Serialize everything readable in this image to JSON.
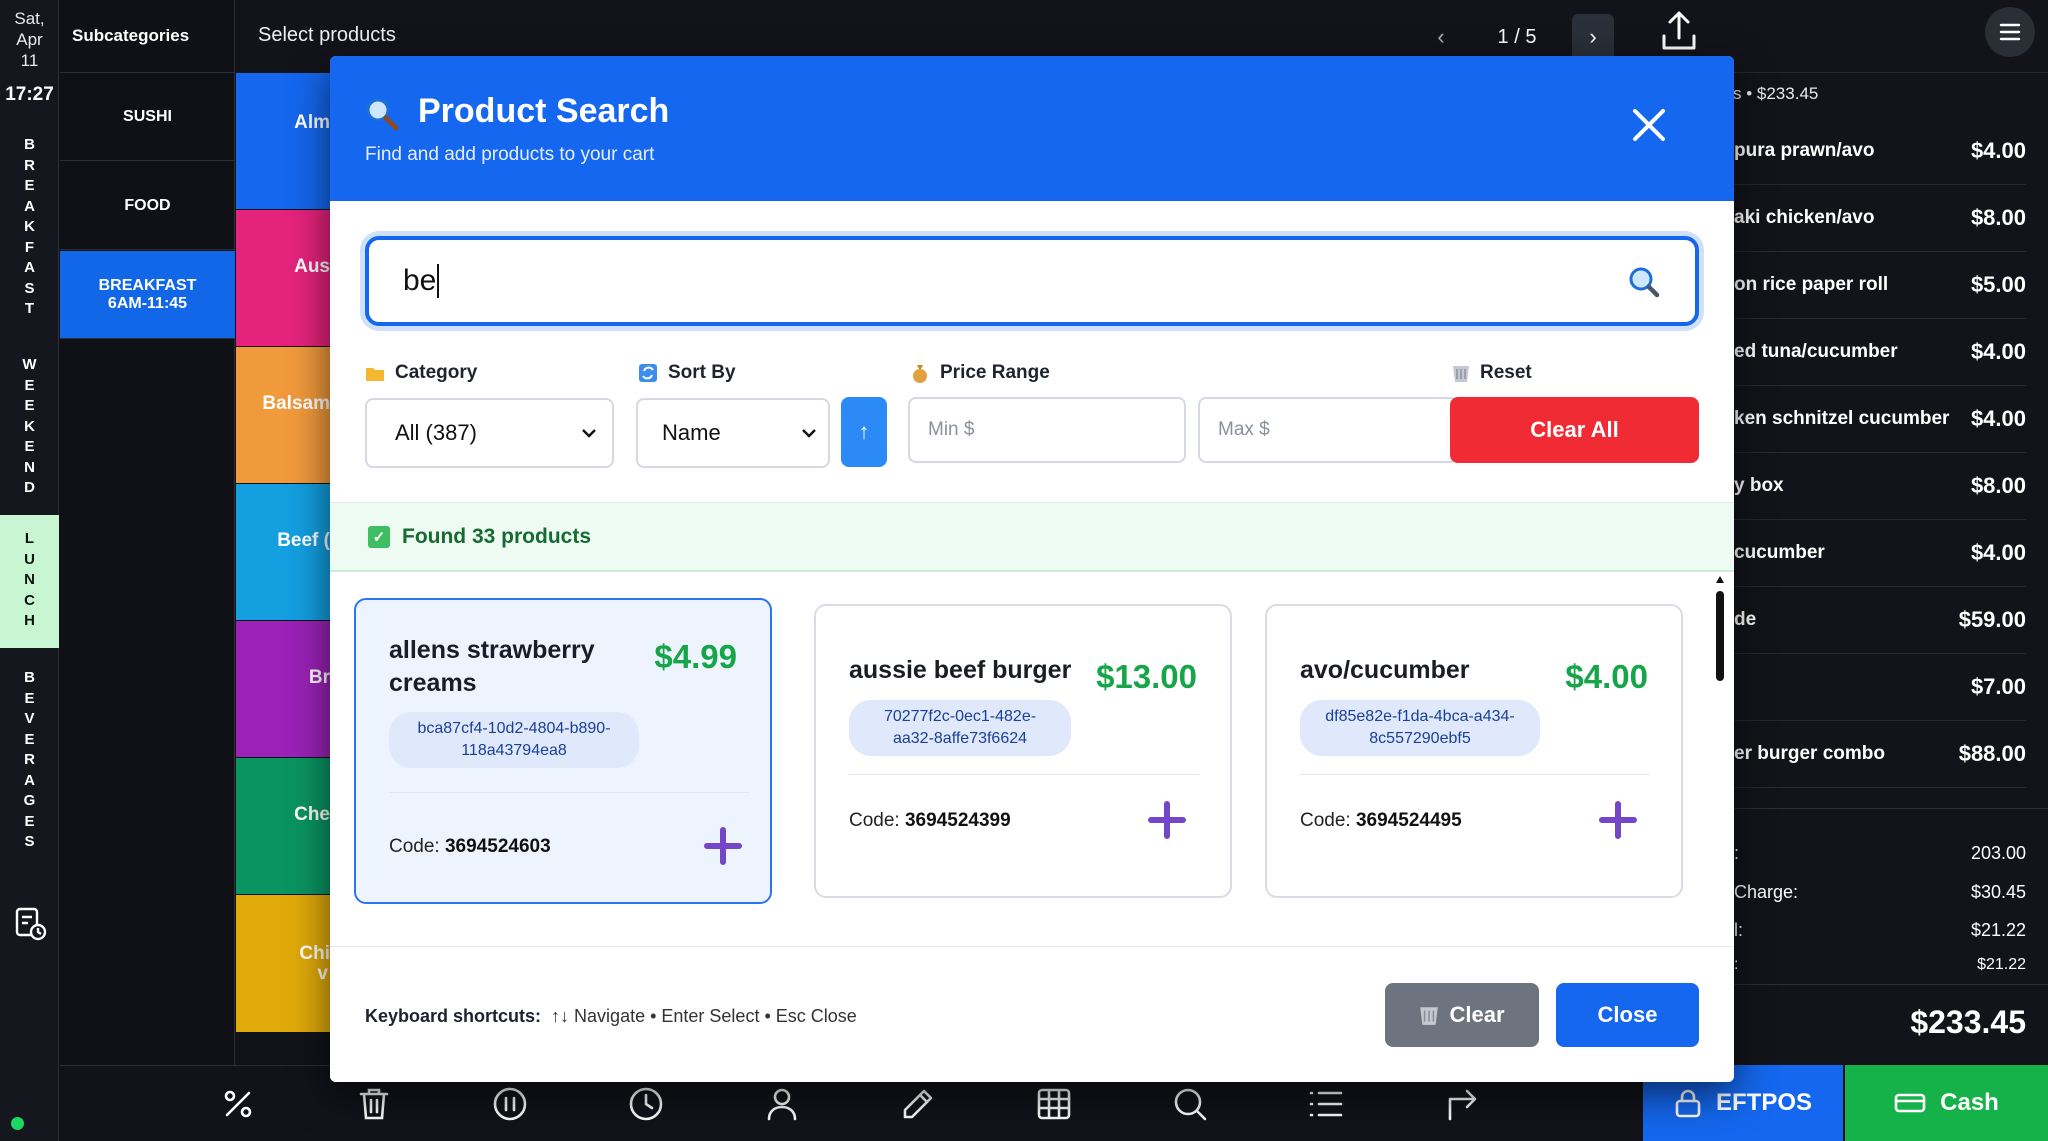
{
  "rail": {
    "date_lines": [
      "Sat,",
      "Apr",
      "11"
    ],
    "time": "17:27",
    "sections": [
      {
        "letters": [
          "B",
          "R",
          "E",
          "A",
          "K",
          "F",
          "A",
          "S",
          "T"
        ]
      },
      {
        "letters": [
          "W",
          "E",
          "E",
          "K",
          "E",
          "N",
          "D"
        ]
      },
      {
        "letters": [
          "L",
          "U",
          "N",
          "C",
          "H"
        ],
        "active": true
      },
      {
        "letters": [
          "B",
          "E",
          "V",
          "E",
          "R",
          "A",
          "G",
          "E",
          "S"
        ]
      }
    ]
  },
  "subcategories": {
    "title": "Subcategories",
    "items": [
      {
        "label": "SUSHI"
      },
      {
        "label": "FOOD"
      },
      {
        "label": "BREAKFAST 6AM-11:45",
        "active": true
      }
    ]
  },
  "products": {
    "title": "Select products",
    "page": "1 / 5",
    "prev": "‹",
    "next": "›",
    "tiles": [
      {
        "label": "Alm",
        "color": "#1467ee"
      },
      {
        "label": "Aus",
        "color": "#e5237c"
      },
      {
        "label": "Balsam",
        "color": "#f09a3c"
      },
      {
        "label": "Beef (",
        "color": "#139fe0"
      },
      {
        "label": "Br",
        "color": "#9b22b8"
      },
      {
        "label": "Che",
        "color": "#0a9462"
      },
      {
        "label": "Chi",
        "label2": "v",
        "color": "#e0aa0a"
      }
    ]
  },
  "cart": {
    "summary": "s • $233.45",
    "items": [
      {
        "name": "pura prawn/avo",
        "price": "$4.00"
      },
      {
        "name": "aki chicken/avo",
        "price": "$8.00"
      },
      {
        "name": "on rice paper roll",
        "price": "$5.00"
      },
      {
        "name": "ed tuna/cucumber",
        "price": "$4.00"
      },
      {
        "name": "ken schnitzel cucumber",
        "price": "$4.00"
      },
      {
        "name": "y box",
        "price": "$8.00"
      },
      {
        "name": "cucumber",
        "price": "$4.00"
      },
      {
        "name": "de",
        "price": "$59.00"
      },
      {
        "name": "",
        "price": "$7.00"
      },
      {
        "name": "er burger combo",
        "price": "$88.00"
      }
    ],
    "totals": [
      {
        "label": ":",
        "value": "203.00"
      },
      {
        "label": "Charge:",
        "value": "$30.45"
      },
      {
        "label": "l:",
        "value": "$21.22"
      },
      {
        "label": ":",
        "value": "$21.22"
      }
    ],
    "grand_total": "$233.45",
    "eftpos": "EFTPOS",
    "cash": "Cash"
  },
  "modal": {
    "title": "Product Search",
    "subtitle": "Find and add products to your cart",
    "search_value": "be",
    "filters": {
      "category_label": "Category",
      "category_value": "All (387)",
      "sort_label": "Sort By",
      "sort_value": "Name",
      "sort_dir": "↑",
      "price_label": "Price Range",
      "min_placeholder": "Min $",
      "max_placeholder": "Max $",
      "reset_label": "Reset",
      "clear_all": "Clear All"
    },
    "found_text": "Found 33 products",
    "code_label": "Code:",
    "results": [
      {
        "name": "allens strawberry creams",
        "price": "$4.99",
        "id": "bca87cf4-10d2-4804-b890-118a43794ea8",
        "code": "3694524603",
        "selected": true
      },
      {
        "name": "aussie beef burger",
        "price": "$13.00",
        "id": "70277f2c-0ec1-482e-aa32-8affe73f6624",
        "code": "3694524399"
      },
      {
        "name": "avo/cucumber",
        "price": "$4.00",
        "id": "df85e82e-f1da-4bca-a434-8c557290ebf5",
        "code": "3694524495"
      }
    ],
    "shortcuts_label": "Keyboard shortcuts:",
    "shortcuts_text": "↑↓ Navigate • Enter Select • Esc Close",
    "clear_btn": "Clear",
    "close_btn": "Close"
  }
}
